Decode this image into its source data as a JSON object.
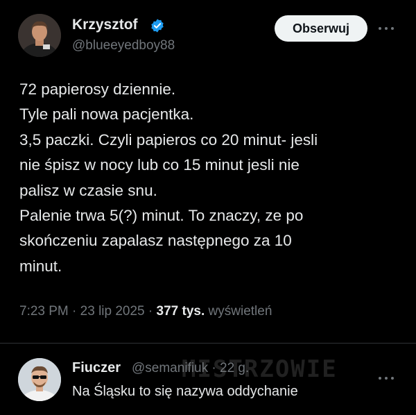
{
  "tweet": {
    "author": {
      "name": "Krzysztof",
      "handle": "@blueeyedboy88",
      "verified": true
    },
    "follow_label": "Obserwuj",
    "body_lines": [
      "72 papierosy dziennie.",
      "Tyle pali nowa pacjentka.",
      "3,5 paczki. Czyli papieros co 20 minut- jesli",
      "nie śpisz w nocy lub co 15 minut jesli nie",
      "palisz w czasie snu.",
      "Palenie trwa 5(?) minut. To znaczy, ze po",
      "skończeniu zapalasz następnego za 10",
      "minut."
    ],
    "time": "7:23 PM",
    "date": "23 lip 2025",
    "separator": "·",
    "views_count": "377 tys.",
    "views_label": "wyświetleń"
  },
  "reply": {
    "name": "Fiuczer",
    "handle": "@semanifiuk",
    "age": "· 22 g.",
    "text": "Na Śląsku to się nazywa oddychanie"
  },
  "watermark": "MISTRZOWIE",
  "colors": {
    "background": "#000000",
    "text": "#e7e9ea",
    "secondary": "#71767b",
    "verified": "#1d9bf0",
    "follow_bg": "#eff3f4",
    "divider": "#2f3336"
  },
  "icons": {
    "verified": "verified-badge-icon",
    "more": "more-options-icon"
  }
}
